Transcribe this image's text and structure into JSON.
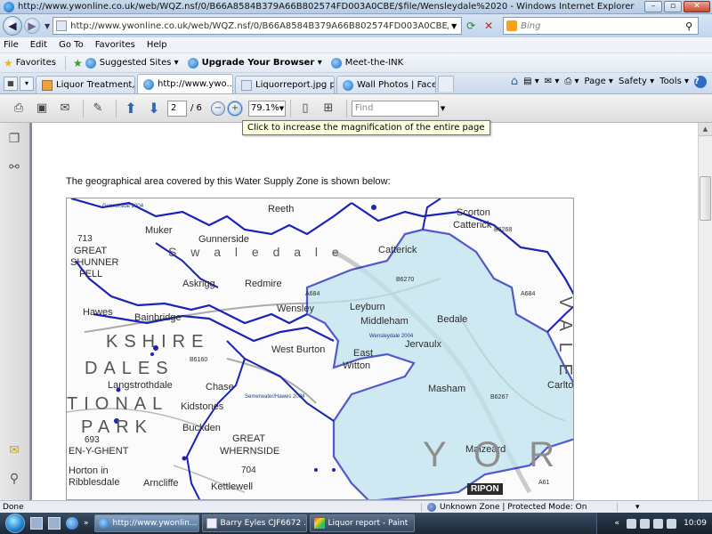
{
  "window": {
    "title": "http://www.ywonline.co.uk/web/WQZ.nsf/0/B66A8584B379A66B802574FD003A0CBE/$file/Wensleydale%2020 - Windows Internet Explorer",
    "minimize": "–",
    "maximize": "▫",
    "close": "✕"
  },
  "address": {
    "url": "http://www.ywonline.co.uk/web/WQZ.nsf/0/B66A8584B379A66B802574FD003A0CBE/$file/Wensleydale",
    "search_placeholder": "Bing"
  },
  "menu": [
    "File",
    "Edit",
    "Go To",
    "Favorites",
    "Help"
  ],
  "favorites_bar": {
    "favorites_label": "Favorites",
    "suggested": "Suggested Sites ▾",
    "upgrade": "Upgrade Your Browser ▾",
    "meet": "Meet-the-INK"
  },
  "tabs": [
    {
      "label": "Liquor Treatment, o...",
      "icon": "orange"
    },
    {
      "label": "http://www.ywo...",
      "icon": "ie",
      "active": true
    },
    {
      "label": "Liquorreport.jpg pic...",
      "icon": "doc"
    },
    {
      "label": "Wall Photos | Faceb...",
      "icon": "ie"
    }
  ],
  "command_bar": {
    "page": "Page ▾",
    "safety": "Safety ▾",
    "tools": "Tools ▾",
    "help": "?"
  },
  "pdf_toolbar": {
    "page_current": "2",
    "page_total": "/ 6",
    "zoom": "79.1%",
    "find_placeholder": "Find"
  },
  "tooltip": "Click to increase the magnification of the entire page",
  "document": {
    "caption": "The geographical area covered by this Water Supply Zone is shown below:"
  },
  "map": {
    "labels": {
      "reeth": "Reeth",
      "scorton": "Scorton",
      "catterick": "Catterick",
      "great_shunner": "GREAT",
      "shunner": "SHUNNER",
      "fell": "FELL",
      "n713": "713",
      "swaledale": "S w a l e d a l e",
      "gunnerside": "Gunnerside",
      "muker": "Muker",
      "askrigg": "Askrigg",
      "redmire": "Redmire",
      "leyburn": "Leyburn",
      "middleham": "Middleham",
      "bedale": "Bedale",
      "jervaulx": "Jervaulx",
      "hawes": "Hawes",
      "bainbridge": "Bainbridge",
      "wensley": "Wensley",
      "kshire": "KSHIRE",
      "dales": "DALES",
      "tional": "TIONAL",
      "park": "PARK",
      "west_burton": "West Burton",
      "east_witton": "East",
      "witton": "Witton",
      "masham": "Masham",
      "chase": "Chase",
      "langstrothdale": "Langstrothdale",
      "kidstones": "Kidstones",
      "buckden": "Buckden",
      "great_whernside": "GREAT",
      "whernside": "WHERNSIDE",
      "n704": "704",
      "n693": "693",
      "penyghent": "EN-Y-GHENT",
      "horton": "Horton in",
      "ribblesdale": "Ribblesdale",
      "arncliffe": "Arncliffe",
      "kettlewell": "Kettlewell",
      "ripon": "RIPON",
      "malzeard": "Malzeard",
      "carlton": "Carlton",
      "vale": "V A L E",
      "york": "Y O R",
      "zone1": "Gunnerside 2004",
      "zone2": "Wensleydale 2004",
      "zone3": "Semerwater/Hawes 2004",
      "road1": "B6270",
      "road2": "A684",
      "road3": "B6160",
      "road4": "B6267",
      "road5": "A61",
      "road6": "B6268",
      "road7": "A684"
    }
  },
  "status": {
    "done": "Done",
    "zone": "Unknown Zone | Protected Mode: On",
    "zoom_ctrl": "▾"
  },
  "taskbar": {
    "tasks": [
      {
        "label": "http://www.ywonlin...",
        "icon": "ie",
        "active": true
      },
      {
        "label": "Barry Eyles CJF6672 ...",
        "icon": "doc"
      },
      {
        "label": "Liquor report - Paint",
        "icon": "paint"
      }
    ],
    "clock": "10:09",
    "tray_more": "«"
  }
}
